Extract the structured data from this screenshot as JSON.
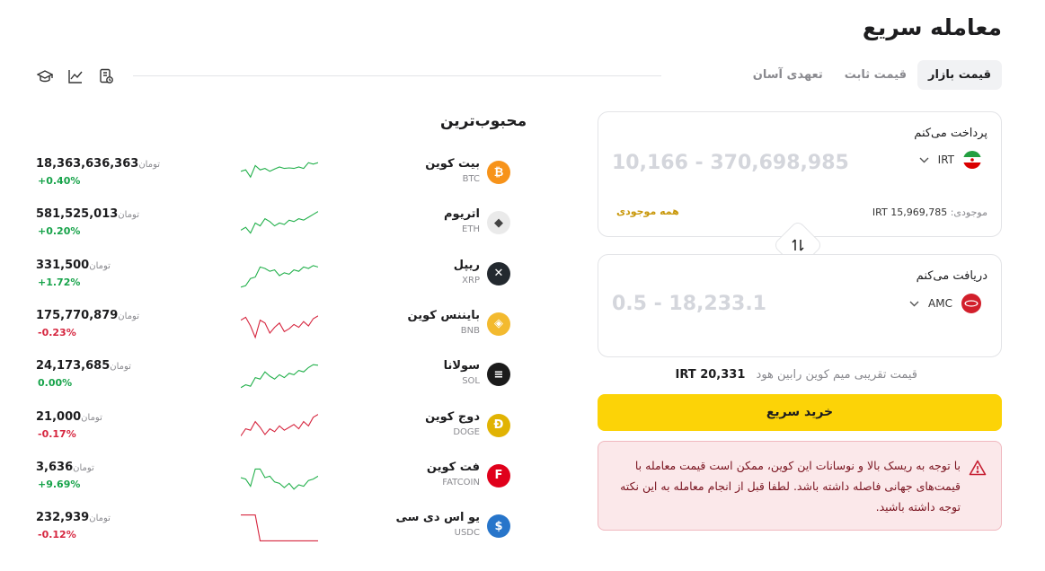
{
  "page": {
    "title": "معامله سریع"
  },
  "tabs": [
    {
      "label": "قیمت بازار",
      "active": true
    },
    {
      "label": "قیمت ثابت",
      "active": false
    },
    {
      "label": "تعهدی آسان",
      "active": false
    }
  ],
  "tool_icons": [
    "academy-icon",
    "chart-icon",
    "order-history-icon"
  ],
  "pay": {
    "label": "پرداخت می‌کنم",
    "range": "10,166 - 370,698,985",
    "currency": "IRT",
    "balance_label": "موجودی:",
    "balance_value": "15,969,785 IRT",
    "all_balance": "همه موجودی"
  },
  "receive": {
    "label": "دریافت می‌کنم",
    "range": "0.5 - 18,233.1",
    "currency": "AMC"
  },
  "approx": {
    "label": "قیمت تقریبی میم کوین رابین هود",
    "value": "20,331 IRT"
  },
  "buy_button": "خرید سریع",
  "warning": "با توجه به ریسک بالا و نوسانات این کوین، ممکن است قیمت معامله با قیمت‌های جهانی فاصله داشته باشد. لطفا قبل از انجام معامله به این نکته توجه داشته باشید.",
  "popular": {
    "title": "محبوب‌ترین",
    "unit": "تومان",
    "items": [
      {
        "name": "بیت کوین",
        "symbol": "BTC",
        "price": "18,363,636,363",
        "change": "+0.40%",
        "trend": "up",
        "color": "#f7931a",
        "glyph": "₿",
        "spark": [
          0.4,
          0.35,
          0.6,
          0.2,
          0.35,
          0.3,
          0.4,
          0.32,
          0.25,
          0.3,
          0.28,
          0.3,
          0.25,
          0.3,
          0.1,
          0.15,
          0.1
        ]
      },
      {
        "name": "اتریوم",
        "symbol": "ETH",
        "price": "581,525,013",
        "change": "+0.20%",
        "trend": "up",
        "color": "#eaeaea",
        "glyph": "◆",
        "spark": [
          0.7,
          0.6,
          0.8,
          0.45,
          0.55,
          0.3,
          0.4,
          0.55,
          0.45,
          0.5,
          0.35,
          0.4,
          0.3,
          0.35,
          0.25,
          0.15,
          0.05
        ]
      },
      {
        "name": "ریپل",
        "symbol": "XRP",
        "price": "331,500",
        "change": "+1.72%",
        "trend": "up",
        "color": "#23292f",
        "glyph": "✕",
        "spark": [
          0.9,
          0.85,
          0.6,
          0.55,
          0.2,
          0.25,
          0.35,
          0.3,
          0.5,
          0.4,
          0.45,
          0.3,
          0.35,
          0.2,
          0.25,
          0.15,
          0.2
        ]
      },
      {
        "name": "بایننس کوین",
        "symbol": "BNB",
        "price": "175,770,879",
        "change": "-0.23%",
        "trend": "down",
        "color": "#f3ba2f",
        "glyph": "◈",
        "spark": [
          0.3,
          0.2,
          0.5,
          0.9,
          0.3,
          0.4,
          0.75,
          0.55,
          0.4,
          0.7,
          0.6,
          0.45,
          0.55,
          0.35,
          0.5,
          0.25,
          0.15
        ]
      },
      {
        "name": "سولانا",
        "symbol": "SOL",
        "price": "24,173,685",
        "change": "0.00%",
        "trend": "up",
        "color": "#1b1b1b",
        "glyph": "≡",
        "spark": [
          0.9,
          0.8,
          0.85,
          0.55,
          0.6,
          0.35,
          0.5,
          0.6,
          0.45,
          0.55,
          0.4,
          0.45,
          0.3,
          0.35,
          0.2,
          0.1,
          0.12
        ]
      },
      {
        "name": "دوج کوین",
        "symbol": "DOGE",
        "price": "21,000",
        "change": "-0.17%",
        "trend": "down",
        "color": "#e1b303",
        "glyph": "Ð",
        "spark": [
          0.8,
          0.55,
          0.6,
          0.3,
          0.5,
          0.75,
          0.55,
          0.65,
          0.45,
          0.6,
          0.5,
          0.4,
          0.55,
          0.3,
          0.45,
          0.15,
          0.05
        ]
      },
      {
        "name": "فت کوین",
        "symbol": "FATCOIN",
        "price": "3,636",
        "change": "+9.69%",
        "trend": "up",
        "color": "#e0001b",
        "glyph": "F",
        "spark": [
          0.5,
          0.55,
          0.8,
          0.2,
          0.2,
          0.5,
          0.45,
          0.65,
          0.7,
          0.85,
          0.7,
          0.9,
          0.75,
          0.8,
          0.6,
          0.55,
          0.45
        ]
      },
      {
        "name": "یو اس دی سی",
        "symbol": "USDC",
        "price": "232,939",
        "change": "-0.12%",
        "trend": "down",
        "color": "#2775ca",
        "glyph": "$",
        "spark": [
          0.05,
          0.05,
          0.05,
          0.05,
          0.95,
          0.95,
          0.95,
          0.95,
          0.95,
          0.95,
          0.95,
          0.95,
          0.95,
          0.95,
          0.95,
          0.95,
          0.95
        ]
      }
    ]
  }
}
